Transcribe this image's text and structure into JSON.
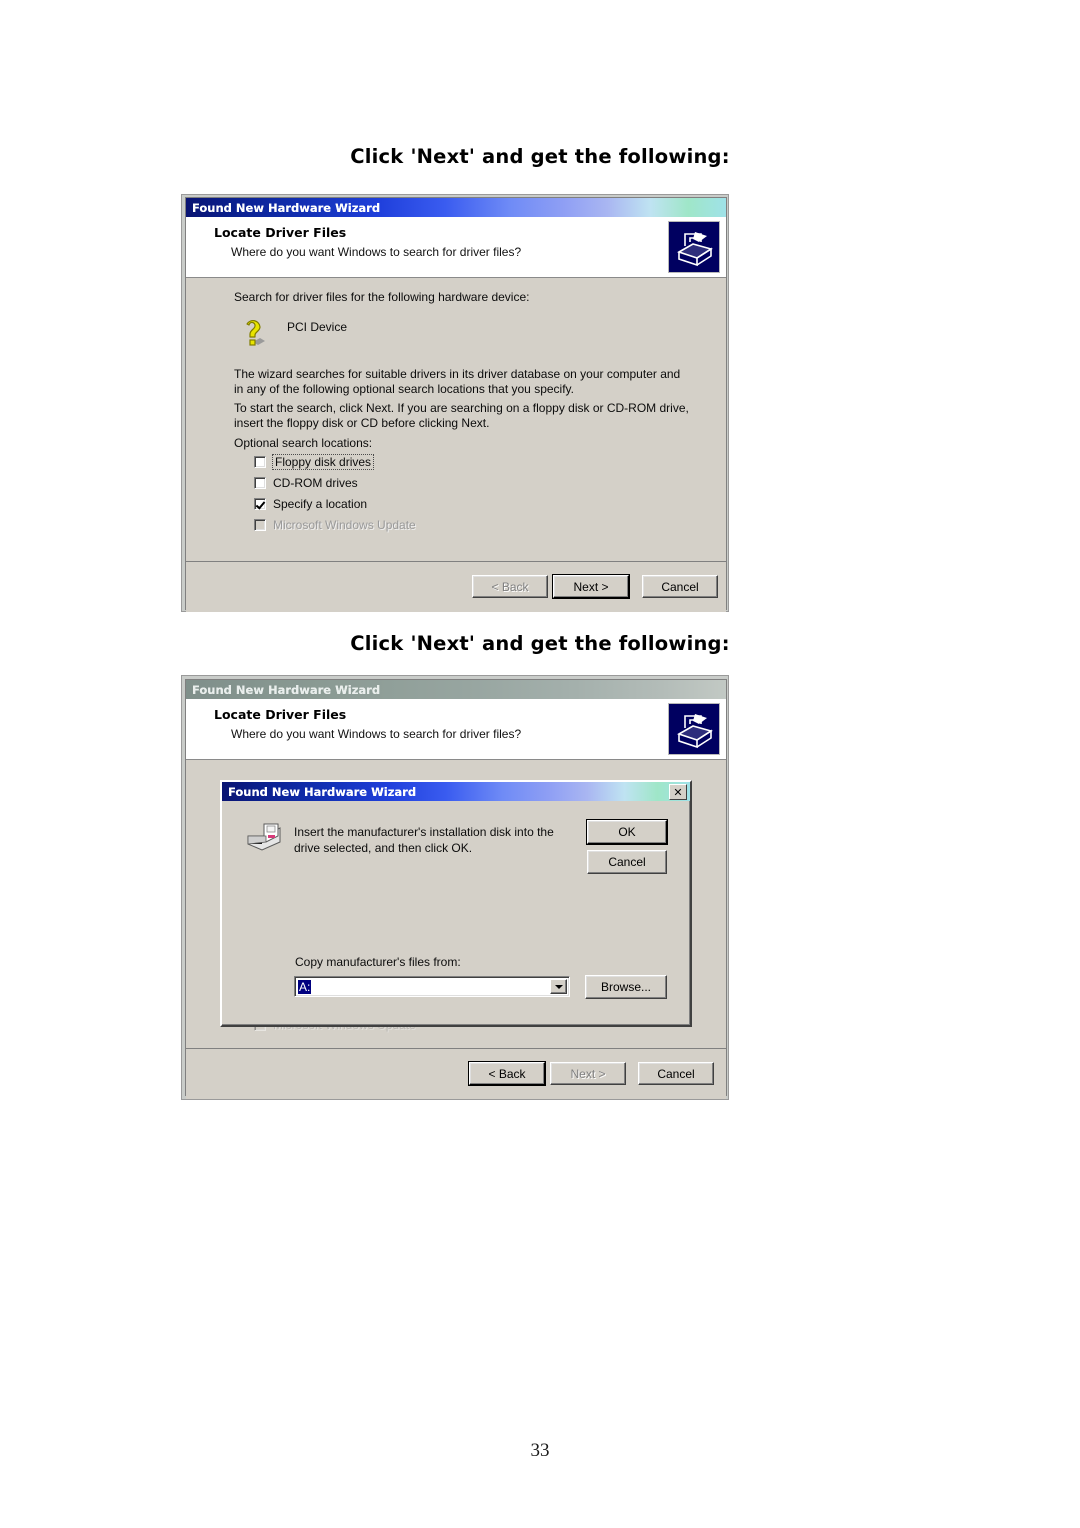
{
  "document": {
    "heading_1": "Click 'Next' and get the following:",
    "heading_2": "Click 'Next' and get the following:",
    "page_number": "33"
  },
  "wizard_1": {
    "titlebar": "Found New Hardware Wizard",
    "header_title": "Locate Driver Files",
    "header_subtitle": "Where do you want Windows to search for driver files?",
    "header_icon": "driver-search-icon",
    "intro": "Search for driver files for the following hardware device:",
    "device_icon": "unknown-device-question-icon",
    "device_name": "PCI Device",
    "paragraph_1": "The wizard searches for suitable drivers in its driver database on your computer and in any of the following optional search locations that you specify.",
    "paragraph_2": "To start the search, click Next. If you are searching on a floppy disk or CD-ROM drive, insert the floppy disk or CD before clicking Next.",
    "optional_label": "Optional search locations:",
    "checkboxes": [
      {
        "label": "Floppy disk drives",
        "checked": false,
        "disabled": false,
        "focused": true
      },
      {
        "label": "CD-ROM drives",
        "checked": false,
        "disabled": false,
        "focused": false
      },
      {
        "label": "Specify a location",
        "checked": true,
        "disabled": false,
        "focused": false
      },
      {
        "label": "Microsoft Windows Update",
        "checked": false,
        "disabled": true,
        "focused": false
      }
    ],
    "buttons": {
      "back": "< Back",
      "next": "Next >",
      "cancel": "Cancel"
    }
  },
  "wizard_2": {
    "titlebar": "Found New Hardware Wizard",
    "header_title": "Locate Driver Files",
    "header_subtitle": "Where do you want Windows to search for driver files?",
    "header_icon": "driver-search-icon",
    "obscured_checkbox": "Microsoft Windows Update",
    "buttons": {
      "back": "< Back",
      "next": "Next >",
      "cancel": "Cancel"
    }
  },
  "modal": {
    "titlebar": "Found New Hardware Wizard",
    "close_icon": "close-icon",
    "disk_icon": "floppy-drive-icon",
    "message": "Insert the manufacturer's installation disk into the drive selected, and then click OK.",
    "ok": "OK",
    "cancel": "Cancel",
    "copy_from_label": "Copy manufacturer's files from:",
    "copy_from_value": "A:",
    "browse": "Browse..."
  },
  "colors": {
    "dialog_face": "#d4d0c8",
    "titlebar_active_start": "#0a1472",
    "titlebar_active_end": "#9fe2e8",
    "titlebar_inactive_start": "#7f8f8a",
    "selection": "#000080",
    "wizard_icon_bg": "#000060",
    "device_icon": "#e8e400"
  }
}
